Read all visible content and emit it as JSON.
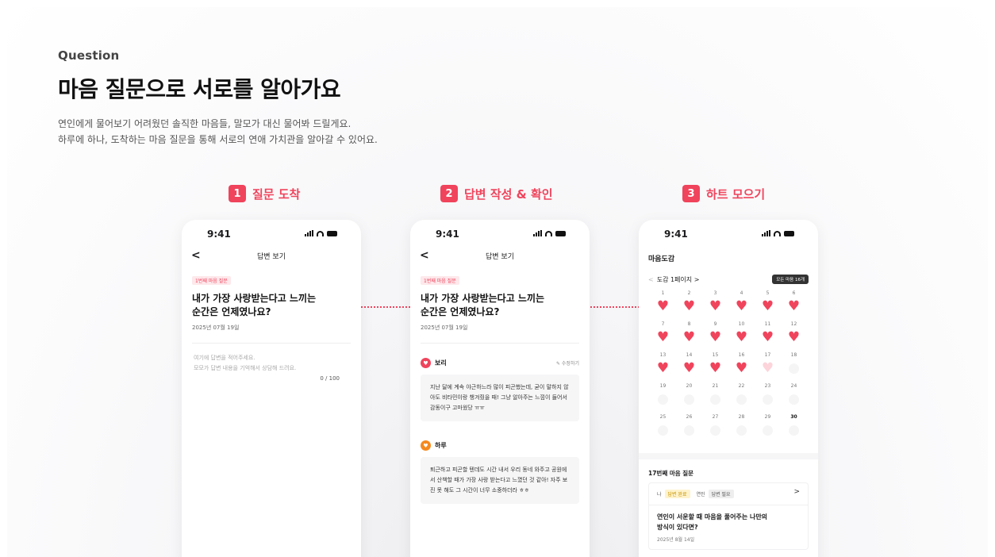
{
  "header": {
    "eyebrow": "Question",
    "headline": "마음 질문으로 서로를 알아가요",
    "desc_line1": "연인에게 물어보기 어려웠던 솔직한 마음들, 말모가 대신 물어봐 드릴게요.",
    "desc_line2": "하루에 하나, 도착하는 마음 질문을 통해 서로의 연애 가치관을 알아갈 수 있어요."
  },
  "steps": [
    {
      "num": "1",
      "label": "질문 도착"
    },
    {
      "num": "2",
      "label": "답변 작성 & 확인"
    },
    {
      "num": "3",
      "label": "하트 모으기"
    }
  ],
  "colors": {
    "accent": "#f0445c",
    "heart_light": "#fcd4da",
    "orange": "#f5891f"
  },
  "phone1": {
    "time": "9:41",
    "back_icon": "chevron-left-icon",
    "nav_title": "답변 보기",
    "tag": "1번째 마음 질문",
    "q_line1": "내가 가장 사랑받는다고 느끼는",
    "q_line2": "순간은 언제였나요?",
    "date": "2025년 07월 19일",
    "placeholder_line1": "여기에 답변을 적어주세요.",
    "placeholder_line2": "모모가 답변 내용을 기억해서 상담해 드려요.",
    "counter": "0 / 100"
  },
  "phone2": {
    "time": "9:41",
    "nav_title": "답변 보기",
    "tag": "1번째 마음 질문",
    "q_line1": "내가 가장 사랑받는다고 느끼는",
    "q_line2": "순간은 언제였나요?",
    "date": "2025년 07월 19일",
    "answer1": {
      "name": "보리",
      "edit": "수정하기",
      "text": "지난 달에 계속 야근하느라 많이 피곤했는데, 굳이 말하지 않아도 비타민이랑 챙겨줬을 때! 그냥 알아주는 느낌이 들어서 감동이구 고마웠당 ㅠㅠ"
    },
    "answer2": {
      "name": "하루",
      "text": "퇴근하고 피곤할 텐데도 시간 내서 우리 동네 와주고 공원에서 산책할 때가 가장 사랑 받는다고 느꼈던 것 같아! 자주 보진 못 해도 그 시간이 너무 소중하더라 ㅎㅎ"
    }
  },
  "phone3": {
    "time": "9:41",
    "page_title": "마음도감",
    "pager": "도감 1페이지",
    "all_badge": "모든 마음 16개",
    "calendar": [
      {
        "day": "1",
        "state": "full"
      },
      {
        "day": "2",
        "state": "full"
      },
      {
        "day": "3",
        "state": "full"
      },
      {
        "day": "4",
        "state": "full"
      },
      {
        "day": "5",
        "state": "full"
      },
      {
        "day": "6",
        "state": "full"
      },
      {
        "day": "7",
        "state": "full"
      },
      {
        "day": "8",
        "state": "full"
      },
      {
        "day": "9",
        "state": "full"
      },
      {
        "day": "10",
        "state": "full"
      },
      {
        "day": "11",
        "state": "full"
      },
      {
        "day": "12",
        "state": "full"
      },
      {
        "day": "13",
        "state": "full"
      },
      {
        "day": "14",
        "state": "full"
      },
      {
        "day": "15",
        "state": "full"
      },
      {
        "day": "16",
        "state": "full"
      },
      {
        "day": "17",
        "state": "light"
      },
      {
        "day": "18",
        "state": "empty"
      },
      {
        "day": "19",
        "state": "empty"
      },
      {
        "day": "20",
        "state": "empty"
      },
      {
        "day": "21",
        "state": "empty"
      },
      {
        "day": "22",
        "state": "empty"
      },
      {
        "day": "23",
        "state": "empty"
      },
      {
        "day": "24",
        "state": "empty"
      },
      {
        "day": "25",
        "state": "empty"
      },
      {
        "day": "26",
        "state": "empty"
      },
      {
        "day": "27",
        "state": "empty"
      },
      {
        "day": "28",
        "state": "empty"
      },
      {
        "day": "29",
        "state": "empty"
      },
      {
        "day": "30",
        "state": "empty"
      }
    ],
    "sub_title": "17번째 마음 질문",
    "me_label": "나",
    "me_status": "답변 완료",
    "partner_label": "연인",
    "partner_status": "답변 필요",
    "card_q_line1": "연인이 서운할 때 마음을 풀어주는 나만의",
    "card_q_line2": "방식이 있다면?",
    "card_date": "2025년 8월 14일"
  }
}
